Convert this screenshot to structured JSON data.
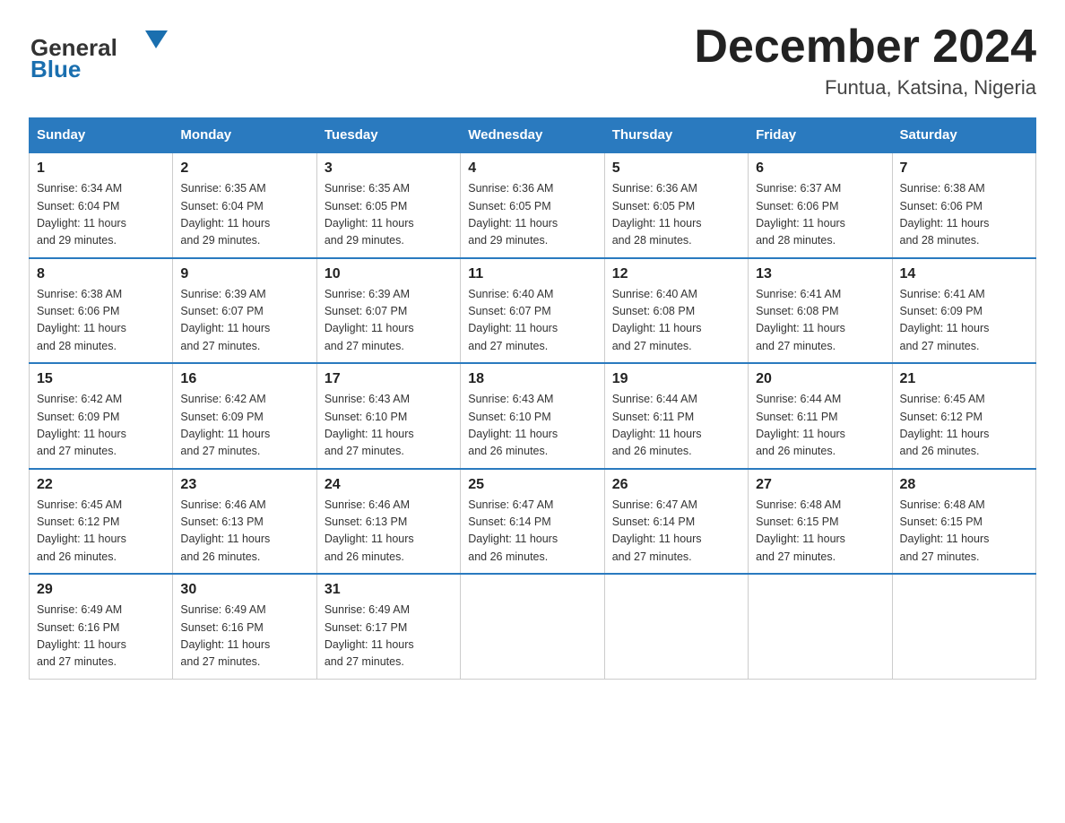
{
  "header": {
    "logo_general": "General",
    "logo_blue": "Blue",
    "month_title": "December 2024",
    "location": "Funtua, Katsina, Nigeria"
  },
  "days_of_week": [
    "Sunday",
    "Monday",
    "Tuesday",
    "Wednesday",
    "Thursday",
    "Friday",
    "Saturday"
  ],
  "weeks": [
    [
      {
        "day": "1",
        "sunrise": "6:34 AM",
        "sunset": "6:04 PM",
        "daylight": "11 hours and 29 minutes."
      },
      {
        "day": "2",
        "sunrise": "6:35 AM",
        "sunset": "6:04 PM",
        "daylight": "11 hours and 29 minutes."
      },
      {
        "day": "3",
        "sunrise": "6:35 AM",
        "sunset": "6:05 PM",
        "daylight": "11 hours and 29 minutes."
      },
      {
        "day": "4",
        "sunrise": "6:36 AM",
        "sunset": "6:05 PM",
        "daylight": "11 hours and 29 minutes."
      },
      {
        "day": "5",
        "sunrise": "6:36 AM",
        "sunset": "6:05 PM",
        "daylight": "11 hours and 28 minutes."
      },
      {
        "day": "6",
        "sunrise": "6:37 AM",
        "sunset": "6:06 PM",
        "daylight": "11 hours and 28 minutes."
      },
      {
        "day": "7",
        "sunrise": "6:38 AM",
        "sunset": "6:06 PM",
        "daylight": "11 hours and 28 minutes."
      }
    ],
    [
      {
        "day": "8",
        "sunrise": "6:38 AM",
        "sunset": "6:06 PM",
        "daylight": "11 hours and 28 minutes."
      },
      {
        "day": "9",
        "sunrise": "6:39 AM",
        "sunset": "6:07 PM",
        "daylight": "11 hours and 27 minutes."
      },
      {
        "day": "10",
        "sunrise": "6:39 AM",
        "sunset": "6:07 PM",
        "daylight": "11 hours and 27 minutes."
      },
      {
        "day": "11",
        "sunrise": "6:40 AM",
        "sunset": "6:07 PM",
        "daylight": "11 hours and 27 minutes."
      },
      {
        "day": "12",
        "sunrise": "6:40 AM",
        "sunset": "6:08 PM",
        "daylight": "11 hours and 27 minutes."
      },
      {
        "day": "13",
        "sunrise": "6:41 AM",
        "sunset": "6:08 PM",
        "daylight": "11 hours and 27 minutes."
      },
      {
        "day": "14",
        "sunrise": "6:41 AM",
        "sunset": "6:09 PM",
        "daylight": "11 hours and 27 minutes."
      }
    ],
    [
      {
        "day": "15",
        "sunrise": "6:42 AM",
        "sunset": "6:09 PM",
        "daylight": "11 hours and 27 minutes."
      },
      {
        "day": "16",
        "sunrise": "6:42 AM",
        "sunset": "6:09 PM",
        "daylight": "11 hours and 27 minutes."
      },
      {
        "day": "17",
        "sunrise": "6:43 AM",
        "sunset": "6:10 PM",
        "daylight": "11 hours and 27 minutes."
      },
      {
        "day": "18",
        "sunrise": "6:43 AM",
        "sunset": "6:10 PM",
        "daylight": "11 hours and 26 minutes."
      },
      {
        "day": "19",
        "sunrise": "6:44 AM",
        "sunset": "6:11 PM",
        "daylight": "11 hours and 26 minutes."
      },
      {
        "day": "20",
        "sunrise": "6:44 AM",
        "sunset": "6:11 PM",
        "daylight": "11 hours and 26 minutes."
      },
      {
        "day": "21",
        "sunrise": "6:45 AM",
        "sunset": "6:12 PM",
        "daylight": "11 hours and 26 minutes."
      }
    ],
    [
      {
        "day": "22",
        "sunrise": "6:45 AM",
        "sunset": "6:12 PM",
        "daylight": "11 hours and 26 minutes."
      },
      {
        "day": "23",
        "sunrise": "6:46 AM",
        "sunset": "6:13 PM",
        "daylight": "11 hours and 26 minutes."
      },
      {
        "day": "24",
        "sunrise": "6:46 AM",
        "sunset": "6:13 PM",
        "daylight": "11 hours and 26 minutes."
      },
      {
        "day": "25",
        "sunrise": "6:47 AM",
        "sunset": "6:14 PM",
        "daylight": "11 hours and 26 minutes."
      },
      {
        "day": "26",
        "sunrise": "6:47 AM",
        "sunset": "6:14 PM",
        "daylight": "11 hours and 27 minutes."
      },
      {
        "day": "27",
        "sunrise": "6:48 AM",
        "sunset": "6:15 PM",
        "daylight": "11 hours and 27 minutes."
      },
      {
        "day": "28",
        "sunrise": "6:48 AM",
        "sunset": "6:15 PM",
        "daylight": "11 hours and 27 minutes."
      }
    ],
    [
      {
        "day": "29",
        "sunrise": "6:49 AM",
        "sunset": "6:16 PM",
        "daylight": "11 hours and 27 minutes."
      },
      {
        "day": "30",
        "sunrise": "6:49 AM",
        "sunset": "6:16 PM",
        "daylight": "11 hours and 27 minutes."
      },
      {
        "day": "31",
        "sunrise": "6:49 AM",
        "sunset": "6:17 PM",
        "daylight": "11 hours and 27 minutes."
      },
      null,
      null,
      null,
      null
    ]
  ],
  "labels": {
    "sunrise": "Sunrise:",
    "sunset": "Sunset:",
    "daylight": "Daylight:"
  }
}
